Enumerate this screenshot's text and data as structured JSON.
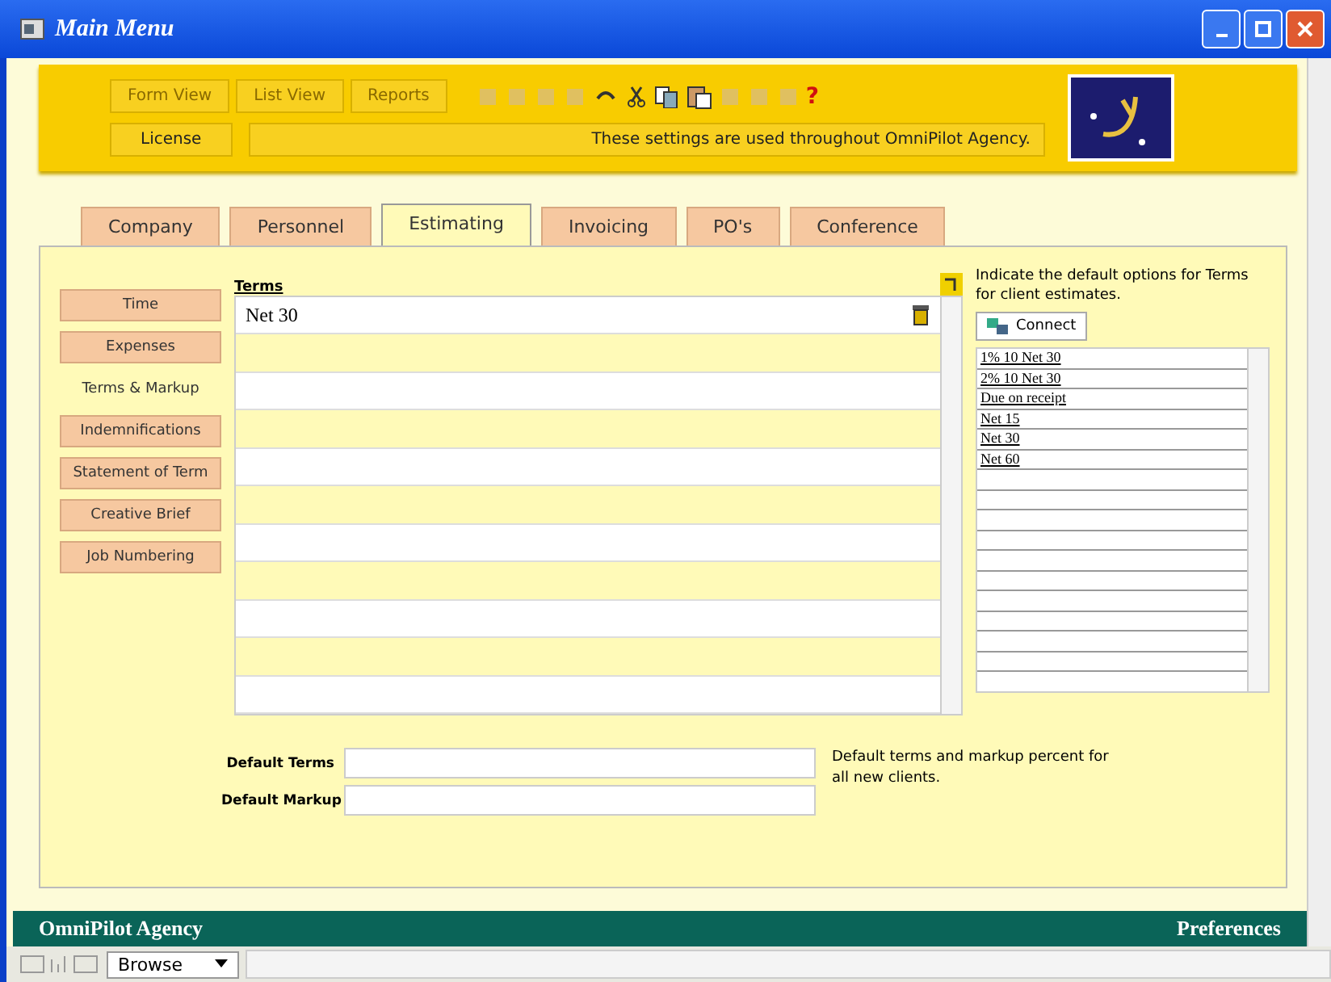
{
  "window": {
    "title": "Main Menu"
  },
  "toolbar": {
    "buttons": [
      {
        "label": "Form View",
        "disabled": true
      },
      {
        "label": "List View",
        "disabled": true
      },
      {
        "label": "Reports",
        "disabled": true
      }
    ],
    "help": "?",
    "license": "License",
    "message": "These settings are used throughout OmniPilot Agency."
  },
  "tabs": [
    {
      "label": "Company",
      "selected": false
    },
    {
      "label": "Personnel",
      "selected": false
    },
    {
      "label": "Estimating",
      "selected": true
    },
    {
      "label": "Invoicing",
      "selected": false
    },
    {
      "label": "PO's",
      "selected": false
    },
    {
      "label": "Conference",
      "selected": false
    }
  ],
  "sidebar": {
    "items": [
      {
        "label": "Time",
        "selected": false
      },
      {
        "label": "Expenses",
        "selected": false
      },
      {
        "label": "Terms & Markup",
        "selected": true
      },
      {
        "label": "Indemnifications",
        "selected": false
      },
      {
        "label": "Statement of Term",
        "selected": false
      },
      {
        "label": "Creative Brief",
        "selected": false
      },
      {
        "label": "Job Numbering",
        "selected": false
      }
    ]
  },
  "terms": {
    "header": "Terms",
    "rows": [
      {
        "value": "Net 30"
      },
      {
        "value": ""
      },
      {
        "value": ""
      },
      {
        "value": ""
      },
      {
        "value": ""
      },
      {
        "value": ""
      },
      {
        "value": ""
      },
      {
        "value": ""
      },
      {
        "value": ""
      },
      {
        "value": ""
      },
      {
        "value": ""
      }
    ]
  },
  "options": {
    "hint": "Indicate the default options for Terms for client estimates.",
    "connect": "Connect",
    "items": [
      "1% 10 Net 30",
      "2% 10 Net 30",
      "Due on receipt",
      "Net 15",
      "Net 30",
      "Net 60"
    ]
  },
  "defaults": {
    "terms_label": "Default Terms",
    "markup_label": "Default Markup",
    "hint": "Default terms and markup percent for all new clients."
  },
  "status_bar": {
    "left": "OmniPilot Agency",
    "right": "Preferences"
  },
  "bottom_bar": {
    "mode": "Browse"
  }
}
